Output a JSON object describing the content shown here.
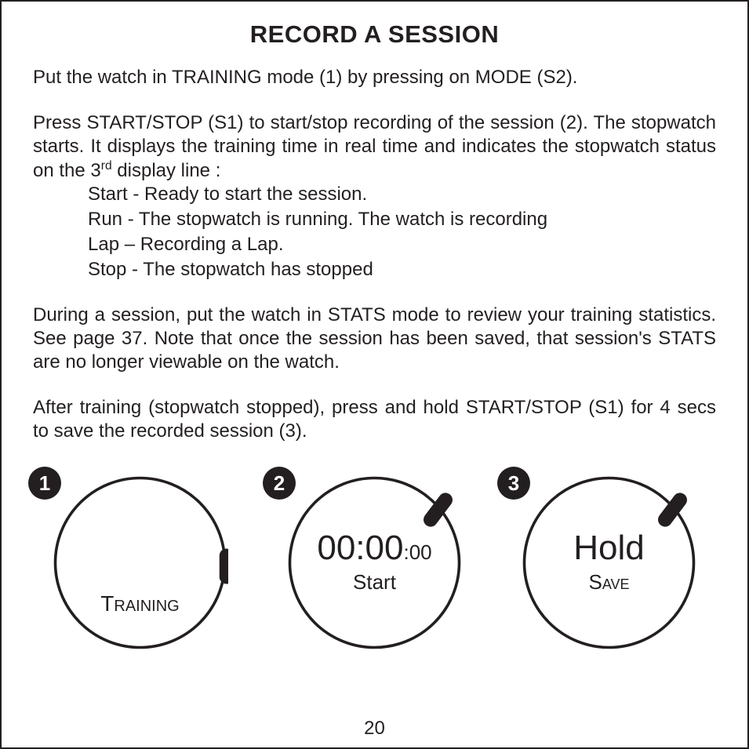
{
  "title": "RECORD A SESSION",
  "para1": "Put the watch in TRAINING mode (1) by pressing on MODE (S2).",
  "para2_a": "Press START/STOP (S1) to start/stop recording of the session (2). The stopwatch starts. It displays the training time in real time and indicates the stopwatch status on the 3",
  "para2_sup": "rd",
  "para2_b": " display line :",
  "status_lines": {
    "s1": "Start - Ready to start the session.",
    "s2": "Run - The stopwatch is running. The watch is recording",
    "s3": "Lap – Recording a Lap.",
    "s4": "Stop - The stopwatch has stopped"
  },
  "para3": "During a session, put the watch in STATS mode to review your training statistics. See page 37. Note that once the session has been saved, that session's STATS are no longer viewable on the watch.",
  "para4": "After training (stopwatch stopped), press and hold START/STOP (S1) for 4 secs to save the recorded session (3).",
  "dials": {
    "d1": {
      "badge": "1",
      "label": "Training"
    },
    "d2": {
      "badge": "2",
      "time_main": "00:00",
      "time_sec": ":00",
      "label": "Start"
    },
    "d3": {
      "badge": "3",
      "main": "Hold",
      "label": "Save"
    }
  },
  "page_number": "20"
}
